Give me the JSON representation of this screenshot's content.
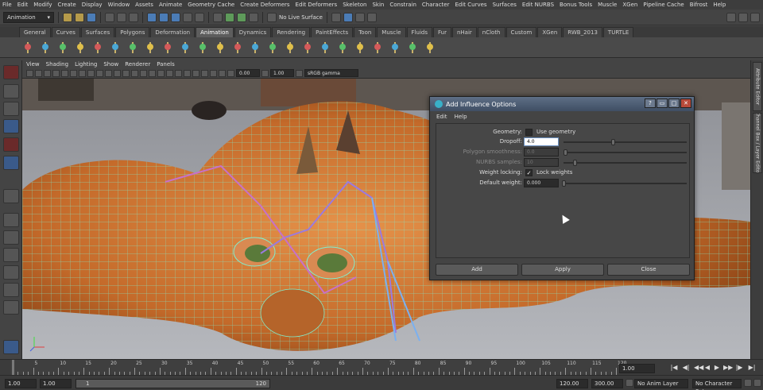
{
  "menubar": {
    "items": [
      "File",
      "Edit",
      "Modify",
      "Create",
      "Display",
      "Window",
      "Assets",
      "Animate",
      "Geometry Cache",
      "Create Deformers",
      "Edit Deformers",
      "Skeleton",
      "Skin",
      "Constrain",
      "Character",
      "Edit Curves",
      "Surfaces",
      "Edit NURBS",
      "Bonus Tools",
      "Muscle",
      "XGen",
      "Pipeline Cache",
      "Bifrost",
      "Help"
    ]
  },
  "status": {
    "mode": "Animation",
    "live_surface": "No Live Surface"
  },
  "shelf_tabs": {
    "items": [
      "General",
      "Curves",
      "Surfaces",
      "Polygons",
      "Deformation",
      "Animation",
      "Dynamics",
      "Rendering",
      "PaintEffects",
      "Toon",
      "Muscle",
      "Fluids",
      "Fur",
      "nHair",
      "nCloth",
      "Custom",
      "XGen",
      "RWB_2013",
      "TURTLE"
    ],
    "active": "Animation"
  },
  "panel": {
    "menu": [
      "View",
      "Shading",
      "Lighting",
      "Show",
      "Renderer",
      "Panels"
    ],
    "near_value": "0.00",
    "far_value": "1.00",
    "color_space": "sRGB gamma"
  },
  "side_tabs": [
    "Attribute Editor",
    "Channel Box / Layer Editor"
  ],
  "dialog": {
    "title": "Add Influence Options",
    "menu": [
      "Edit",
      "Help"
    ],
    "geometry_label": "Geometry:",
    "use_geometry_label": "Use geometry",
    "use_geometry_checked": false,
    "dropoff_label": "Dropoff:",
    "dropoff_value": "4.0",
    "poly_smooth_label": "Polygon smoothness:",
    "poly_smooth_value": "0.0",
    "nurbs_samples_label": "NURBS samples:",
    "nurbs_samples_value": "10",
    "weight_locking_label": "Weight locking:",
    "lock_weights_label": "Lock weights",
    "lock_weights_checked": true,
    "lock_weights_mark": "✓",
    "default_weight_label": "Default weight:",
    "default_weight_value": "0.000",
    "buttons": {
      "add": "Add",
      "apply": "Apply",
      "close": "Close"
    },
    "win_buttons": {
      "help": "?",
      "min": "▭",
      "max": "□",
      "close": "✕"
    }
  },
  "timeline": {
    "ticks": [
      "5",
      "10",
      "15",
      "20",
      "25",
      "30",
      "35",
      "40",
      "45",
      "50",
      "55",
      "60",
      "65",
      "70",
      "75",
      "80",
      "85",
      "90",
      "95",
      "100",
      "105",
      "110",
      "115",
      "120"
    ],
    "current_frame": "1.00",
    "play_glyphs": [
      "|◀",
      "◀|",
      "◀◀",
      "◀",
      "▶",
      "▶▶",
      "|▶",
      "▶|"
    ]
  },
  "range": {
    "start_time": "1.00",
    "playback_start": "1.00",
    "slider_left": "1",
    "slider_right": "120",
    "playback_end": "120.00",
    "end_time": "300.00",
    "anim_layer": "No Anim Layer",
    "character_set": "No Character Set"
  },
  "colors": {
    "ui_bg": "#444444",
    "title_bar": "#4f5f74",
    "wire": "#66e8c8",
    "skin": "#c9773a"
  }
}
